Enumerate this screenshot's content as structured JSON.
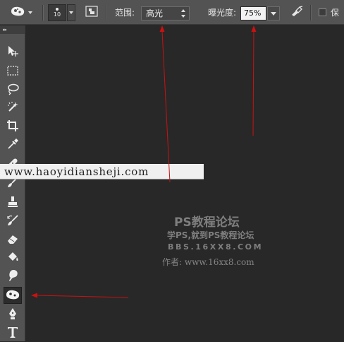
{
  "options_bar": {
    "tool_preset_icon": "sponge-icon",
    "brush_size": "10",
    "range_label": "范围:",
    "range_value": "高光",
    "exposure_label": "曝光度:",
    "exposure_value": "75%",
    "airbrush_icon": "airbrush-icon",
    "protect_label": "保"
  },
  "toolbar": {
    "tools": [
      {
        "name": "move-tool",
        "icon": "move-icon"
      },
      {
        "name": "marquee-tool",
        "icon": "rect-marquee-icon"
      },
      {
        "name": "lasso-tool",
        "icon": "lasso-icon"
      },
      {
        "name": "magic-wand-tool",
        "icon": "magic-wand-icon"
      },
      {
        "name": "crop-tool",
        "icon": "crop-icon"
      },
      {
        "name": "eyedropper-tool",
        "icon": "eyedropper-icon"
      },
      {
        "name": "healing-tool",
        "icon": "bandage-icon"
      },
      {
        "name": "brush-tool",
        "icon": "brush-icon"
      },
      {
        "name": "stamp-tool",
        "icon": "stamp-icon"
      },
      {
        "name": "history-brush-tool",
        "icon": "history-brush-icon"
      },
      {
        "name": "eraser-tool",
        "icon": "eraser-icon"
      },
      {
        "name": "paint-bucket-tool",
        "icon": "paint-bucket-icon"
      },
      {
        "name": "blur-tool",
        "icon": "blur-icon"
      },
      {
        "name": "sponge-tool",
        "icon": "sponge-icon",
        "active": true
      },
      {
        "name": "pen-tool",
        "icon": "pen-icon"
      },
      {
        "name": "type-tool",
        "icon": "type-icon",
        "label": "T"
      }
    ]
  },
  "watermark": {
    "url": "www.haoyidiansheji.com",
    "title": "PS教程论坛",
    "subtitle": "学PS,就到PS教程论坛",
    "bbs": "BBS.16XX8.COM",
    "author": "作者: www.16xx8.com"
  },
  "annotation_color": "#cc1111"
}
